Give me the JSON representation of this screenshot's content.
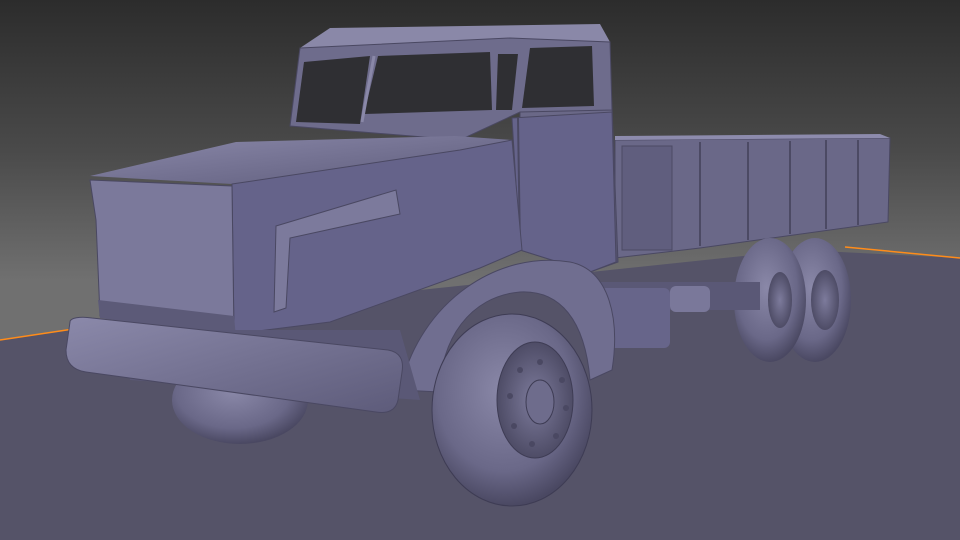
{
  "viewport": {
    "type": "3d-viewport",
    "object": "truck-model",
    "shading": "solid-matcap",
    "colors": {
      "background_top": "#2c2c2c",
      "background_bottom": "#6a6a6a",
      "floor": "#555368",
      "model": "#6e6c8c",
      "model_light": "#8e8cae",
      "model_dark": "#45435a",
      "horizon_line": "#ff8c1a"
    }
  }
}
